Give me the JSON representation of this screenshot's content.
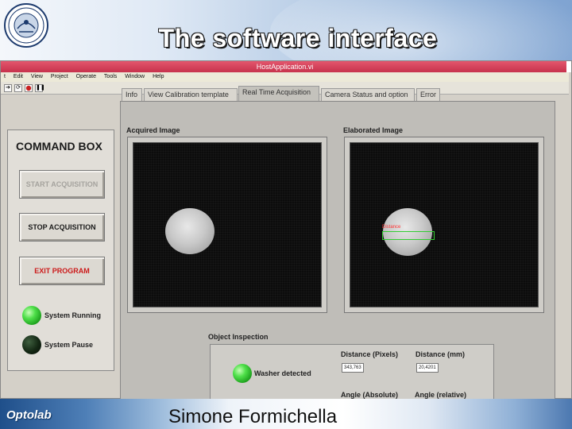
{
  "slide": {
    "title": "The software interface",
    "author": "Simone Formichella",
    "brand": "Optolab"
  },
  "window": {
    "title": "HostApplication.vi",
    "menu": [
      "t",
      "Edit",
      "View",
      "Project",
      "Operate",
      "Tools",
      "Window",
      "Help"
    ],
    "tabs": [
      {
        "label": "Info",
        "active": false
      },
      {
        "label": "View Calibration template",
        "active": false
      },
      {
        "label": "Real Time Acquisition",
        "active": true
      },
      {
        "label": "Camera Status and option",
        "active": false
      },
      {
        "label": "Error",
        "active": false
      }
    ]
  },
  "command_box": {
    "title": "COMMAND BOX",
    "start_label": "START ACQUISITION",
    "stop_label": "STOP ACQUISITION",
    "exit_label": "EXIT PROGRAM",
    "system_running_label": "System Running",
    "system_pause_label": "System Pause",
    "system_running_on": true,
    "system_pause_on": false
  },
  "images": {
    "acquired_label": "Acquired Image",
    "elaborated_label": "Elaborated Image",
    "overlay_label": "Distance"
  },
  "inspection": {
    "title": "Object Inspection",
    "washer_label": "Washer detected",
    "washer_detected": true,
    "distance_pixels_label": "Distance (Pixels)",
    "distance_pixels_value": "343,763",
    "distance_mm_label": "Distance (mm)",
    "distance_mm_value": "20,4201",
    "angle_absolute_label": "Angle (Absolute)",
    "angle_relative_label": "Angle (relative)"
  },
  "colors": {
    "led_on": "#3fd43a",
    "led_off": "#102010",
    "exit_text": "#cc1a1a",
    "titlebar": "#d0405a"
  },
  "icons": [
    "university-seal-icon",
    "run-arrow-icon",
    "run-continuous-icon",
    "abort-icon",
    "pause-icon"
  ]
}
